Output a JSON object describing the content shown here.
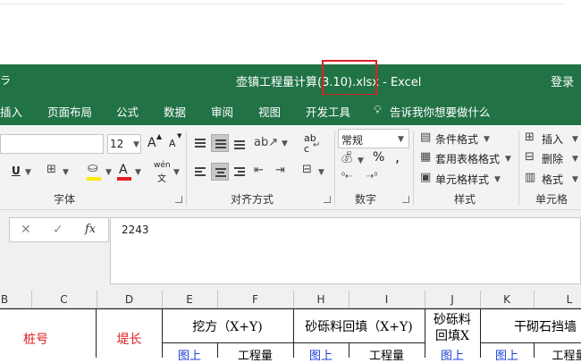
{
  "window": {
    "title": "壶镇工程量计算(3.10).xlsx  -  Excel",
    "login": "登录",
    "left_glyph": "ラ"
  },
  "tabs": [
    "插入",
    "页面布局",
    "公式",
    "数据",
    "审阅",
    "视图",
    "开发工具"
  ],
  "tell_me": "告诉我你想要做什么",
  "ribbon": {
    "font": {
      "label": "字体",
      "size_value": "12",
      "grow_label": "A",
      "shrink_label": "A",
      "underline_label": "U",
      "font_color_label": "A",
      "wen_label": "wén",
      "wen_sub": "文"
    },
    "alignment": {
      "label": "对齐方式",
      "wrap_label": "ab",
      "wrap_sub": "c"
    },
    "number": {
      "label": "数字",
      "format_value": "常规",
      "percent": "%",
      "comma": ","
    },
    "styles": {
      "label": "样式",
      "conditional": "条件格式",
      "table": "套用表格格式",
      "cell": "单元格样式"
    },
    "cells": {
      "label": "单元格",
      "insert": "插入",
      "delete": "删除",
      "format": "格式"
    }
  },
  "formula_bar": {
    "cancel": "✕",
    "enter": "✓",
    "fx": "fx",
    "value": "2243"
  },
  "columns": [
    "B",
    "C",
    "D",
    "E",
    "F",
    "H",
    "I",
    "J",
    "K",
    "L"
  ],
  "sheet": {
    "zhuanghao": "桩号",
    "dichang": "堤长",
    "wafang": "挖方（X+Y)",
    "shali": "砂砾料回填（X+Y)",
    "shali_x_1": "砂砾料",
    "shali_x_2": "回填X",
    "ganqi": "干砌石挡墙",
    "tushang": "图上",
    "gongchengliang": "工程量"
  },
  "colors": {
    "excel_green": "#217346",
    "highlight_red": "#e02020",
    "header_red": "#e02020",
    "header_blue": "#1a3fd6"
  }
}
